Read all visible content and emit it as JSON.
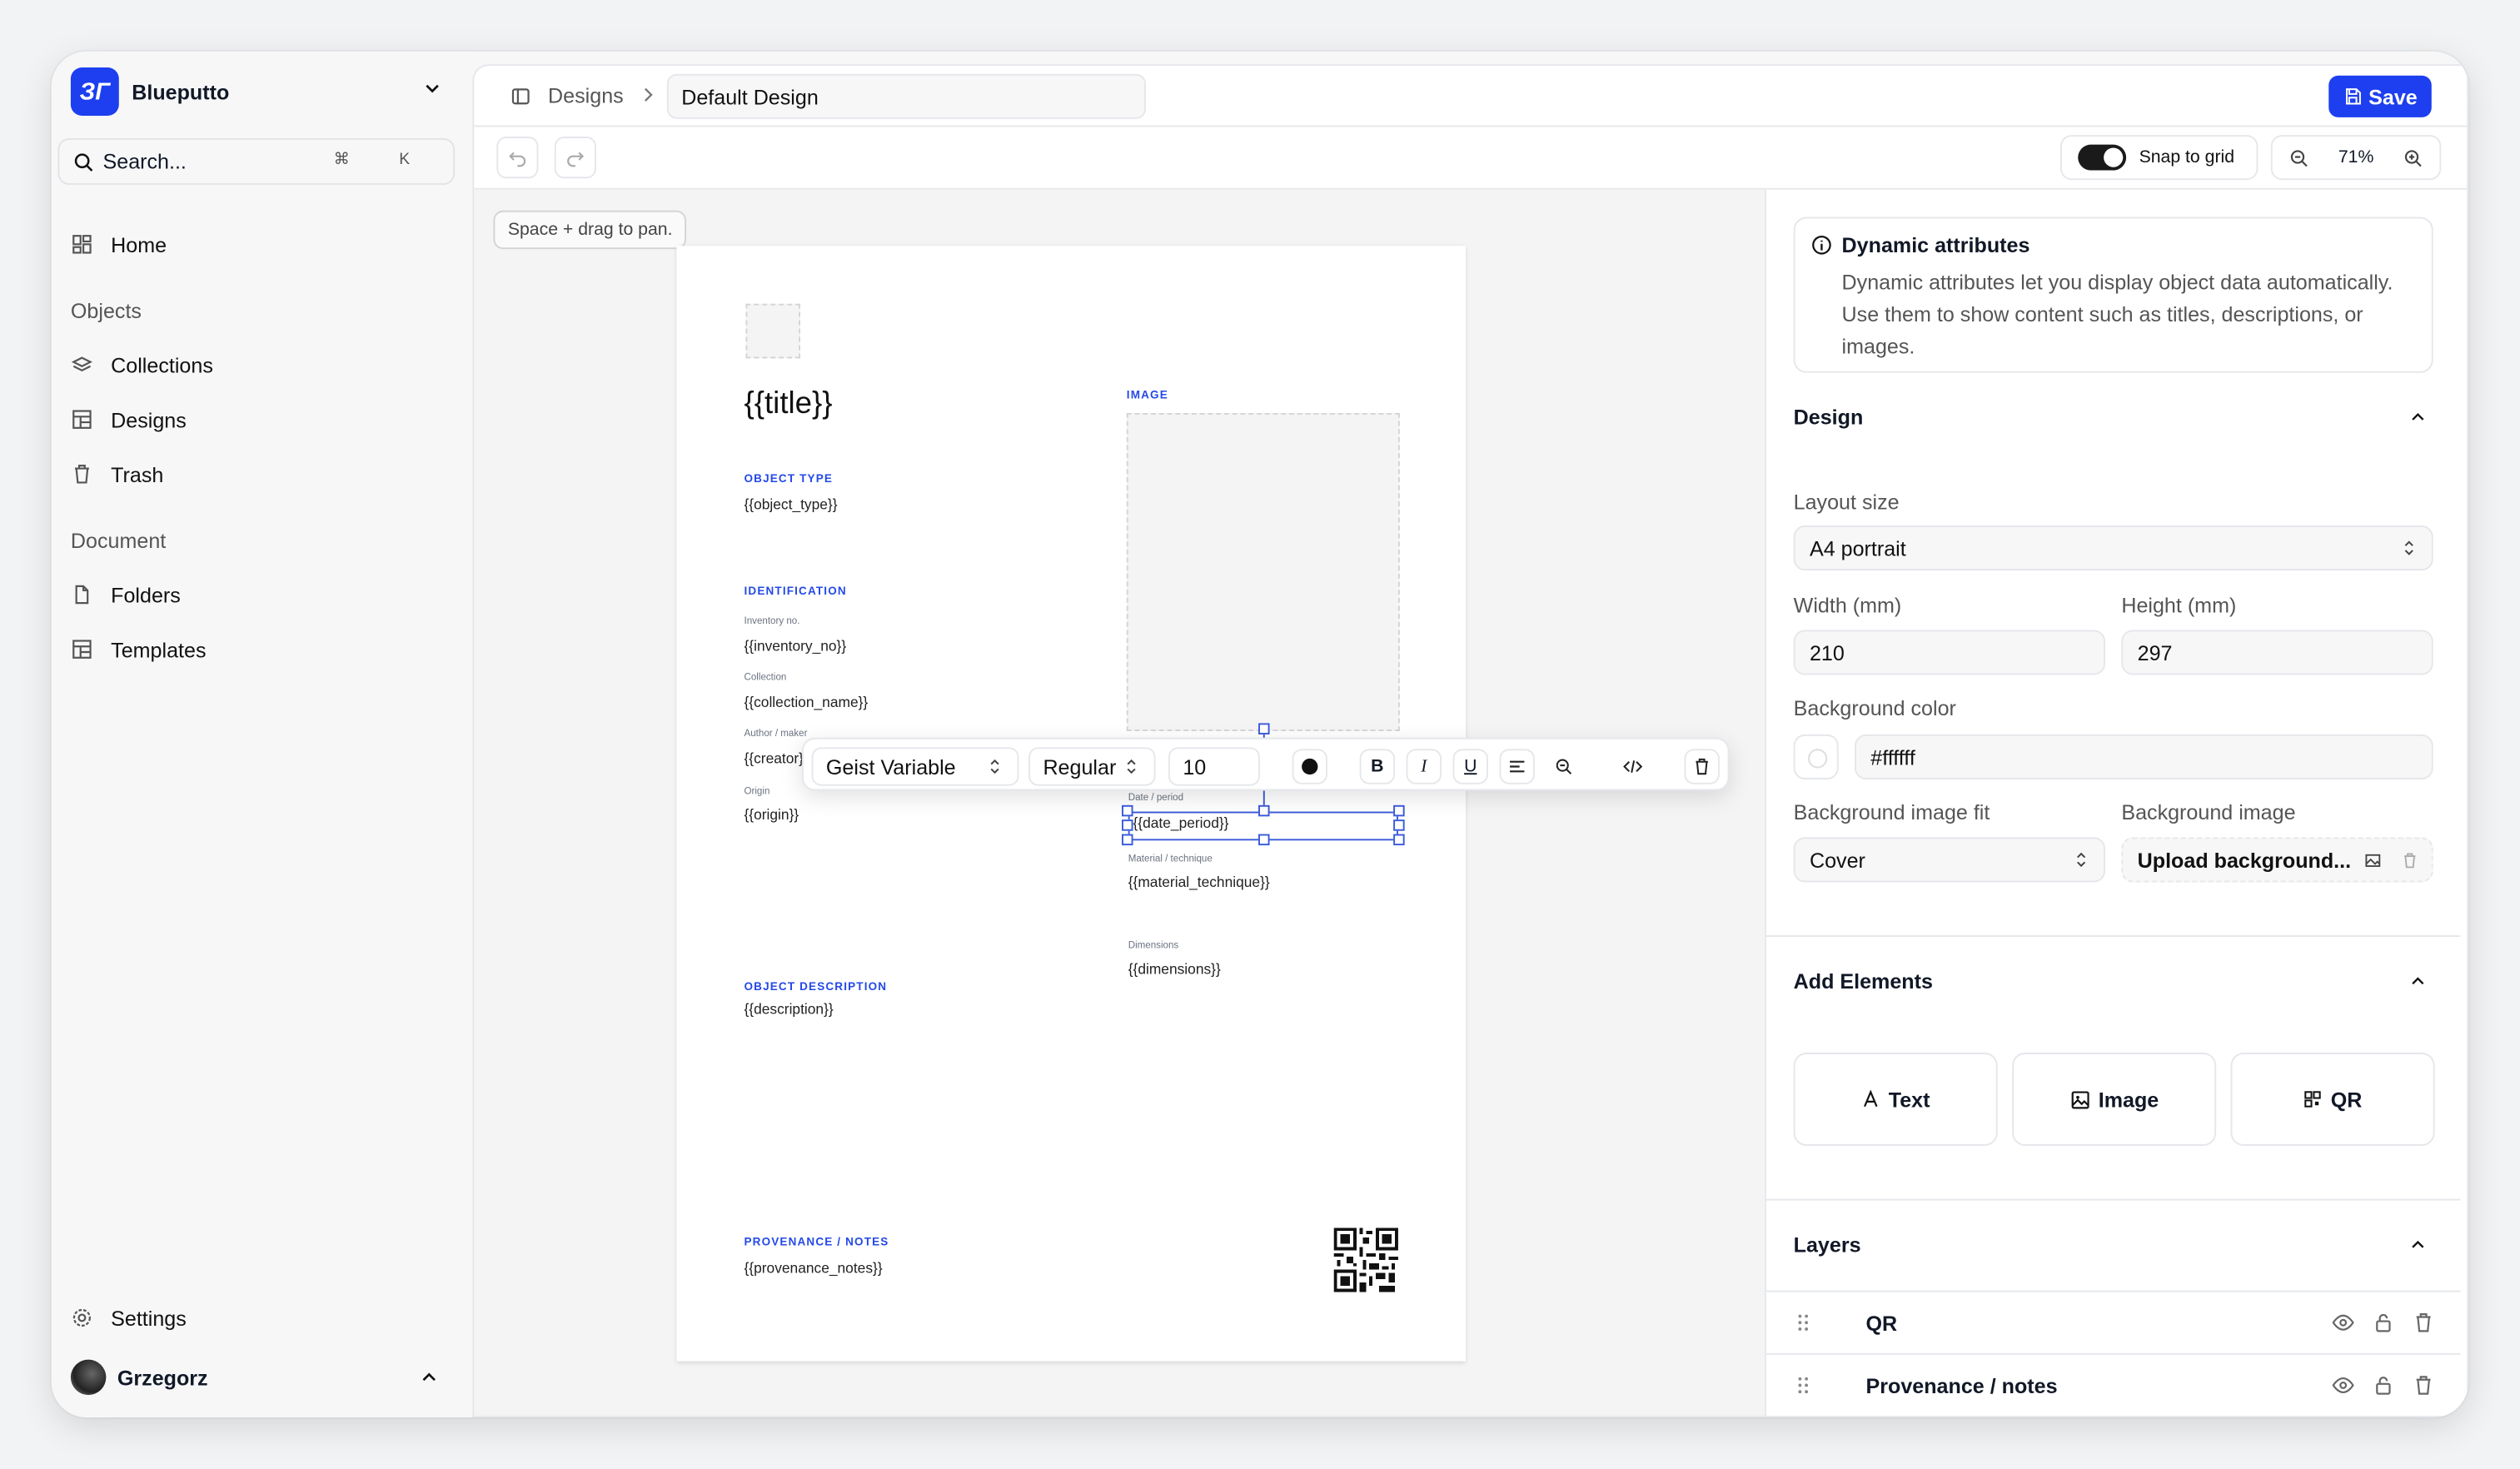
{
  "sidebar": {
    "brand": "Blueputto",
    "search": {
      "placeholder": "Search...",
      "shortcut": "⌘ K"
    },
    "home": "Home",
    "group_objects": "Objects",
    "collections": "Collections",
    "designs": "Designs",
    "trash": "Trash",
    "group_document": "Document",
    "folders": "Folders",
    "templates": "Templates",
    "settings": "Settings",
    "user": "Grzegorz"
  },
  "header": {
    "breadcrumb": "Designs",
    "design_name": "Default Design",
    "save": "Save"
  },
  "toolbar": {
    "snap": "Snap to grid",
    "zoom": "71%"
  },
  "canvas": {
    "pan_hint": "Space + drag to pan.",
    "title": "{{title}}",
    "image_label": "IMAGE",
    "object_type_label": "OBJECT TYPE",
    "object_type": "{{object_type}}",
    "identification_label": "IDENTIFICATION",
    "inventory_label": "Inventory no.",
    "inventory": "{{inventory_no}}",
    "collection_label": "Collection",
    "collection": "{{collection_name}}",
    "author_label": "Author / maker",
    "author": "{{creator}}",
    "origin_label": "Origin",
    "origin": "{{origin}}",
    "date_label": "Date / period",
    "date": "{{date_period}}",
    "material_label": "Material / technique",
    "material": "{{material_technique}}",
    "dimensions_label": "Dimensions",
    "dimensions": "{{dimensions}}",
    "description_label": "OBJECT DESCRIPTION",
    "description": "{{description}}",
    "provenance_label": "PROVENANCE / NOTES",
    "provenance": "{{provenance_notes}}"
  },
  "format_toolbar": {
    "font": "Geist Variable",
    "weight": "Regular",
    "size": "10",
    "bold": "B",
    "italic": "I",
    "underline": "U"
  },
  "panel": {
    "info_title": "Dynamic attributes",
    "info_text": "Dynamic attributes let you display object data automatically. Use them to show content such as titles, descriptions, or images.",
    "design_head": "Design",
    "layout_size_label": "Layout size",
    "layout_size": "A4 portrait",
    "width_label": "Width (mm)",
    "width": "210",
    "height_label": "Height (mm)",
    "height": "297",
    "bg_color_label": "Background color",
    "bg_color": "#ffffff",
    "bg_fit_label": "Background image fit",
    "bg_fit": "Cover",
    "bg_image_label": "Background image",
    "bg_image": "Upload background...",
    "add_head": "Add Elements",
    "add_text": "Text",
    "add_image": "Image",
    "add_qr": "QR",
    "layers_head": "Layers",
    "layers": [
      "QR",
      "Provenance / notes"
    ]
  },
  "colors": {
    "accent": "#1d3ff0",
    "selection": "#3b5bdb",
    "section_label": "#2449e8"
  }
}
